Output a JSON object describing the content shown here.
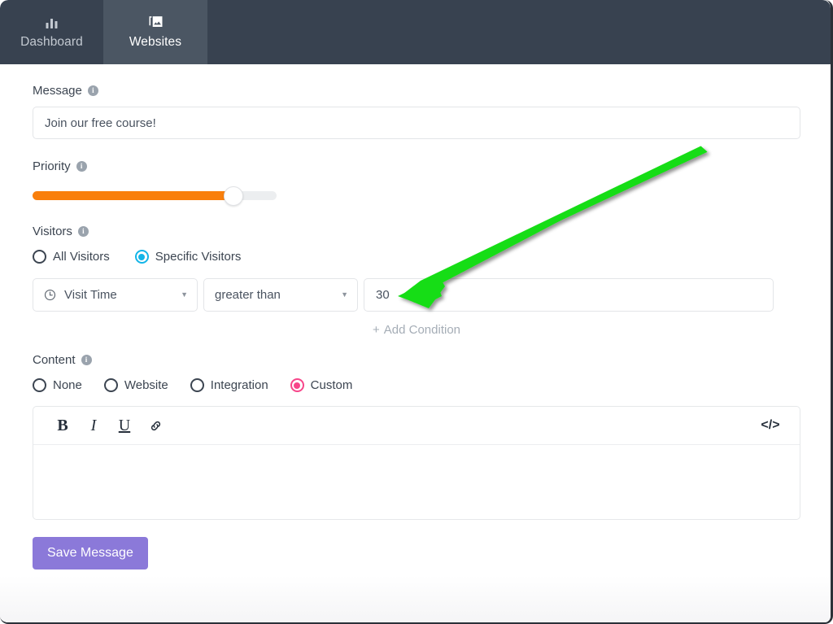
{
  "nav": {
    "tabs": [
      {
        "label": "Dashboard",
        "icon": "bar-chart-icon",
        "active": false
      },
      {
        "label": "Websites",
        "icon": "images-icon",
        "active": true
      }
    ]
  },
  "form": {
    "message": {
      "label": "Message",
      "info": "i",
      "value": "Join our free course!",
      "placeholder": ""
    },
    "priority": {
      "label": "Priority",
      "info": "i",
      "fill_percent": 82
    },
    "visitors": {
      "label": "Visitors",
      "info": "i",
      "options": [
        {
          "label": "All Visitors",
          "selected": false
        },
        {
          "label": "Specific Visitors",
          "selected": true
        }
      ],
      "selected_color": "#13b5e8"
    },
    "condition": {
      "metric": "Visit Time",
      "metric_icon": "clock-icon",
      "operator": "greater than",
      "value": "30",
      "value_placeholder": "",
      "caret": "▼",
      "add_condition": "Add Condition",
      "add_condition_plus": "+"
    },
    "content": {
      "label": "Content",
      "info": "i",
      "options": [
        {
          "label": "None",
          "selected": false
        },
        {
          "label": "Website",
          "selected": false
        },
        {
          "label": "Integration",
          "selected": false
        },
        {
          "label": "Custom",
          "selected": true
        }
      ],
      "selected_color": "#f7468a"
    },
    "editor": {
      "bold": "B",
      "italic": "I",
      "underline": "U",
      "link_icon": "link-icon",
      "code": "</>",
      "body_text": ""
    },
    "save": {
      "label": "Save Message",
      "color": "#8b79d9"
    }
  },
  "annotation": {
    "arrow_color": "#15dd15",
    "points_to": "condition-value-input"
  }
}
